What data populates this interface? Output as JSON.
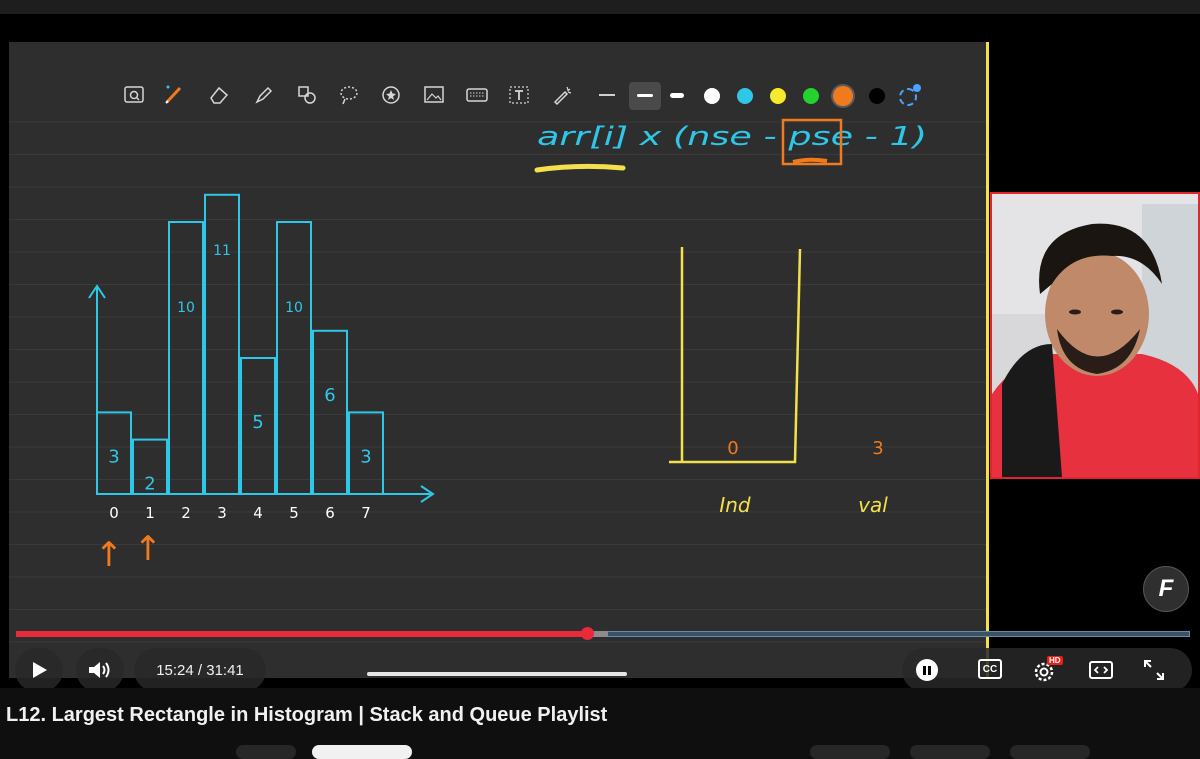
{
  "player": {
    "current_time": "15:24",
    "duration": "31:41",
    "time_display": "15:24 / 31:41",
    "progress_fraction": 0.486,
    "buffered_fraction": 0.504,
    "hd_badge": "HD",
    "cc_label": "CC",
    "brand_badge": "F"
  },
  "video": {
    "title": "L12. Largest Rectangle in Histogram | Stack and Queue Playlist"
  },
  "whiteboard": {
    "toolbar_tools": [
      "search-screen-icon",
      "pen-icon",
      "eraser-icon",
      "highlighter-icon",
      "shapes-icon",
      "lasso-icon",
      "sticker-icon",
      "image-icon",
      "keyboard-icon",
      "text-icon",
      "laser-pointer-icon"
    ],
    "stroke_sizes": [
      "thin",
      "medium",
      "thick"
    ],
    "colors": [
      "#ffffff",
      "#2ec7e8",
      "#f7ea2e",
      "#22d22e",
      "#f07a1e",
      "#000000"
    ],
    "selected_color": "#f07a1e",
    "formula": "arr[i] x (nse - pse - 1)",
    "highlighted_term": "pse",
    "stack_contents": [
      "0"
    ],
    "stack_label": "Ind",
    "value_label": "val",
    "value_shown": "3",
    "accent_yellow": "#f4e04d",
    "chalk_blue": "#2ec7e8",
    "chalk_orange": "#f07a1e"
  },
  "chart_data": {
    "type": "bar",
    "categories": [
      "0",
      "1",
      "2",
      "3",
      "4",
      "5",
      "6",
      "7"
    ],
    "values": [
      3,
      2,
      10,
      11,
      5,
      10,
      6,
      3
    ],
    "labels": [
      "3",
      "2",
      "10",
      "11",
      "5",
      "10",
      "6",
      "3"
    ],
    "xlabel": "",
    "ylabel": "",
    "ylim": [
      0,
      12.5
    ],
    "pointer_indices": [
      0,
      1
    ]
  }
}
